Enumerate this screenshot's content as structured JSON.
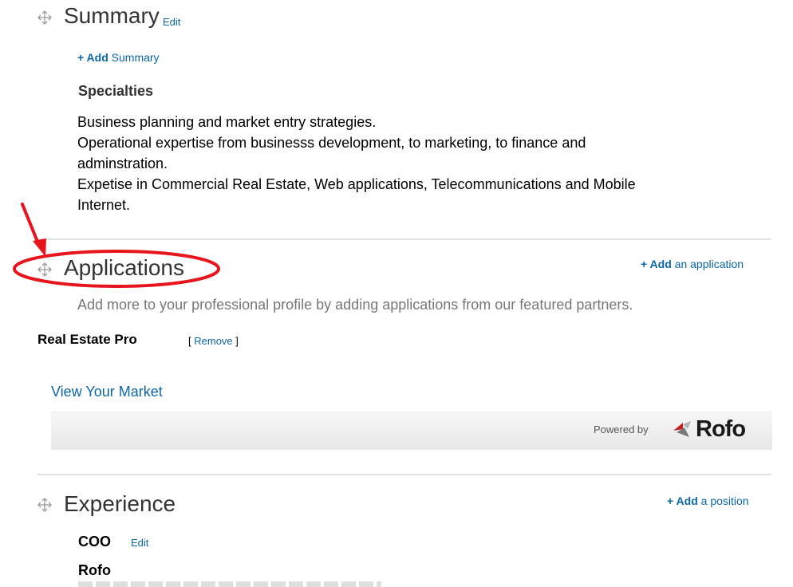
{
  "summary": {
    "title": "Summary",
    "edit_label": "Edit",
    "add_plus": "+ Add",
    "add_rest": " Summary",
    "specialties_heading": "Specialties",
    "specialties_lines": [
      "Business planning and market entry strategies.",
      "Operational expertise from businesss development, to marketing, to finance and",
      "adminstration.",
      "Expetise in Commercial Real Estate, Web applications, Telecommunications and Mobile",
      "Internet."
    ]
  },
  "applications": {
    "title": "Applications",
    "add_plus": "+ Add",
    "add_rest": " an application",
    "description": "Add more to your professional profile by adding applications from our featured partners.",
    "app_name": "Real Estate Pro",
    "remove_open": "[",
    "remove_label": "Remove",
    "remove_close": "]",
    "view_market_label": "View Your Market",
    "powered_by": "Powered by",
    "brand": "Rofo"
  },
  "experience": {
    "title": "Experience",
    "add_plus": "+ Add",
    "add_rest": " a position",
    "position_title": "COO",
    "position_edit": "Edit",
    "company": "Rofo"
  },
  "annotation": {
    "color": "#e8141c"
  },
  "icons": {
    "move": "move-arrows-icon",
    "brand_logo": "rofo-logo-icon",
    "annotation_arrow": "red-arrow-icon",
    "annotation_ellipse": "red-ellipse-highlight"
  }
}
